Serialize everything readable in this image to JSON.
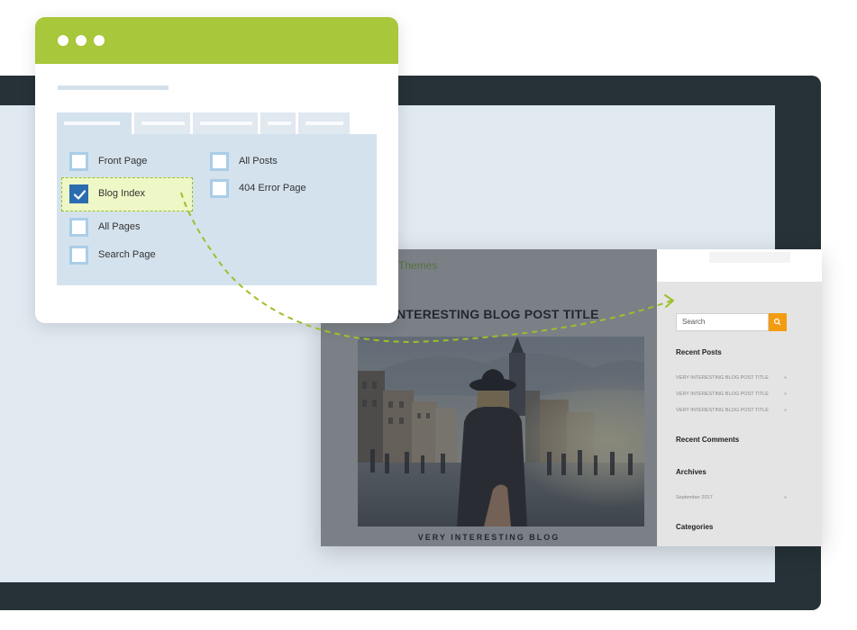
{
  "settings_card": {
    "options": [
      {
        "label": "Front Page",
        "checked": false
      },
      {
        "label": "Blog Index",
        "checked": true
      },
      {
        "label": "All Pages",
        "checked": false
      },
      {
        "label": "Search Page",
        "checked": false
      },
      {
        "label": "All Posts",
        "checked": false
      },
      {
        "label": "404 Error Page",
        "checked": false
      }
    ]
  },
  "preview": {
    "brand": "Themes",
    "post_title": "INTERESTING BLOG POST TITLE",
    "caption": "VERY INTERESTING BLOG",
    "sidebar": {
      "search_placeholder": "Search",
      "recent_posts_heading": "Recent Posts",
      "recent_posts": [
        "VERY INTERESTING BLOG POST TITLE",
        "VERY INTERESTING BLOG POST TITLE",
        "VERY INTERESTING BLOG POST TITLE"
      ],
      "recent_comments_heading": "Recent Comments",
      "archives_heading": "Archives",
      "archives": [
        "September 2017"
      ],
      "categories_heading": "Categories",
      "arrow_glyph": "»"
    }
  },
  "colors": {
    "accent_green": "#a8c73a",
    "checkbox_blue": "#2b6cb0",
    "search_orange": "#f39c12",
    "monitor_frame": "#263238"
  },
  "icons": {
    "check": "check-icon",
    "search": "search-icon"
  }
}
